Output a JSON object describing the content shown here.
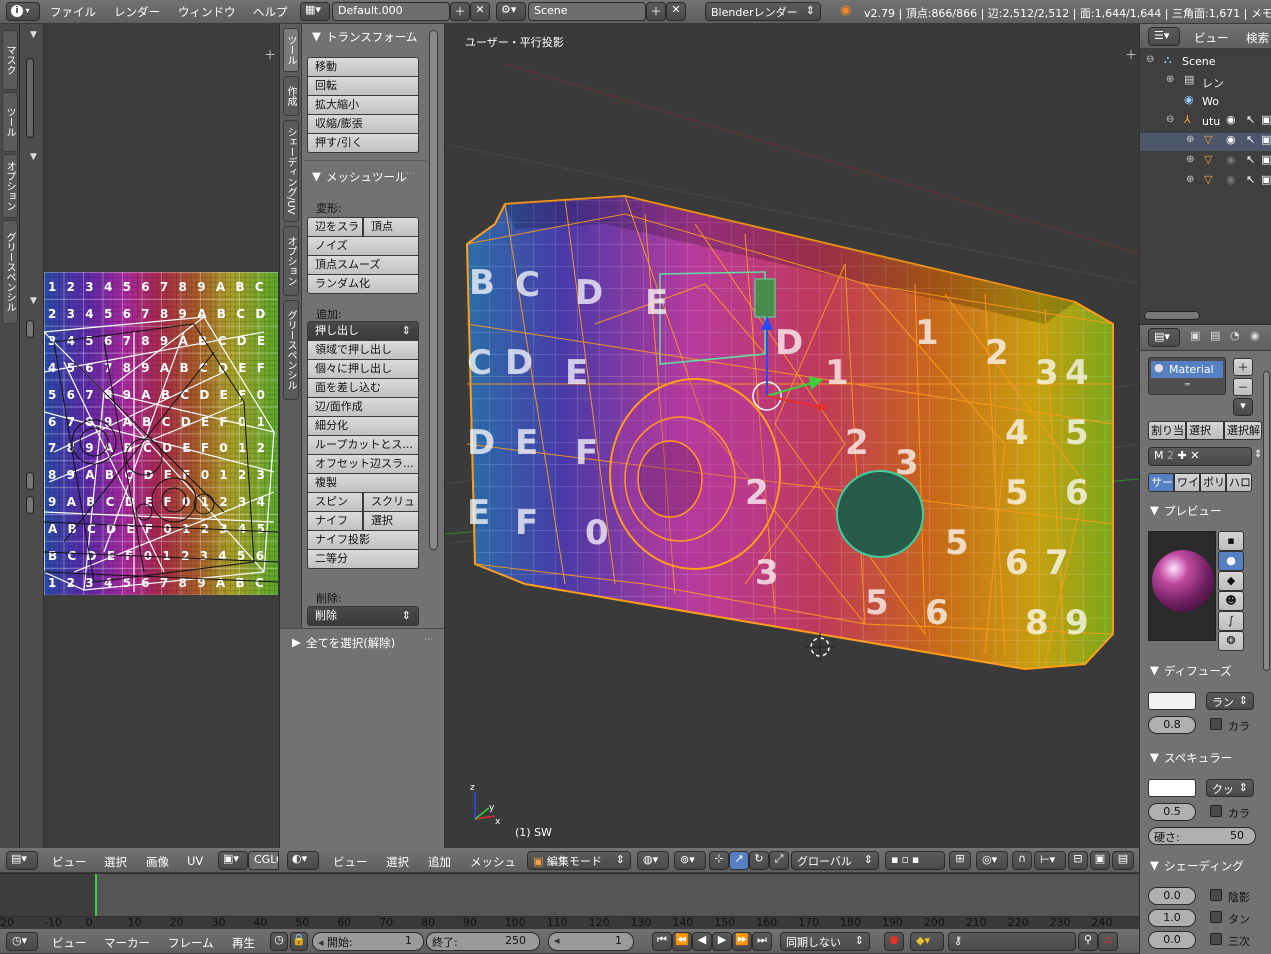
{
  "app": {
    "info_icon": "info-icon",
    "menus": [
      "ファイル",
      "レンダー",
      "ウィンドウ",
      "ヘルプ"
    ],
    "screen_layout": "Default.000",
    "scene": "Scene",
    "engine": "Blenderレンダー",
    "stats": "v2.79 | 頂点:866/866 | 辺:2,512/2,512 | 面:1,644/1,644 | 三角面:1,671 | メモリ"
  },
  "uv_editor": {
    "side_tabs": [
      "マスク",
      "ツール",
      "オプション",
      "グリースペンシル"
    ],
    "grid_rows": [
      "1 2 3 4 5 6 7 8 9 A B C",
      "2 3 4 5 6 7 8 9 A B C D",
      "3 4 5 6 7 8 9 A B C D E",
      "4 5 6 7 8 9 A B C D E F",
      "5 6 7 8 9 A B C D E F 0",
      "6 7 8 9 A B C D E F 0 1",
      "7 8 9 A B C D E F 0 1 2",
      "8 9 A B C D E F 0 1 2 3",
      "9 A B C D E F 0 1 2 3 4",
      "A B C D E F 0 1 2 3 4 5",
      "B C D E F 0 1 2 3 4 5 6",
      "1 2 3 4 5 6 7 8 9 A B C"
    ],
    "header_menus": [
      "ビュー",
      "選択",
      "画像",
      "UV"
    ],
    "image_name": "CGLO"
  },
  "tool_shelf": {
    "tabs": [
      "ツール",
      "作成",
      "シェーディング/UV",
      "オプション",
      "グリースペンシル"
    ],
    "transform": {
      "title": "トランスフォーム",
      "buttons": [
        "移動",
        "回転",
        "拡大縮小",
        "収縮/膨張",
        "押す/引く"
      ]
    },
    "mesh_tools": {
      "title": "メッシュツール",
      "deform_label": "変形:",
      "slide_edge": "辺をスラ",
      "slide_vertex": "頂点",
      "deform_buttons": [
        "ノイズ",
        "頂点スムーズ",
        "ランダム化"
      ],
      "add_label": "追加:",
      "extrude": "押し出し",
      "add_buttons": [
        "領域で押し出し",
        "個々に押し出し",
        "面を差し込む",
        "辺/面作成",
        "細分化",
        "ループカットとス...",
        "オフセット辺スラ...",
        "複製"
      ],
      "spin": "スピン",
      "screw": "スクリュ",
      "knife": "ナイフ",
      "select": "選択",
      "knife_project": "ナイフ投影",
      "bisect": "二等分",
      "delete_label": "削除:",
      "delete": "削除"
    },
    "select_all": "全てを選択(解除)"
  },
  "viewport": {
    "view_label": "ユーザー・平行投影",
    "object_label": "(1) SW",
    "header_menus": [
      "ビュー",
      "選択",
      "追加",
      "メッシュ"
    ],
    "mode": "編集モード",
    "orientation": "グローバル"
  },
  "outliner": {
    "header_menus": [
      "ビュー",
      "検索"
    ],
    "items": [
      "Scene",
      "レン",
      "Wo",
      "utu"
    ]
  },
  "properties": {
    "material_name": "Material",
    "material_buttons": [
      "割り当",
      "選択",
      "選択解"
    ],
    "slot_field": "M",
    "type_tabs": [
      "サー",
      "ワイ",
      "ポリ",
      "ハロ"
    ],
    "preview_title": "プレビュー",
    "diffuse": {
      "title": "ディフューズ",
      "shader": "ラン",
      "intensity": "0.8",
      "ramp": "カラ"
    },
    "specular": {
      "title": "スペキュラー",
      "shader": "クッ",
      "intensity": "0.5",
      "ramp": "カラ",
      "hardness_label": "硬さ:",
      "hardness": "50"
    },
    "shading": {
      "title": "シェーディング",
      "emit": "0.0",
      "shadeless": "陰影",
      "translucency": "1.0",
      "tangent": "タン",
      "ambient": "0.0",
      "cubic": "三次"
    }
  },
  "timeline": {
    "ticks": [
      "-20",
      "-10",
      "0",
      "10",
      "20",
      "30",
      "40",
      "50",
      "60",
      "70",
      "80",
      "90",
      "100",
      "110",
      "120",
      "130",
      "140",
      "150",
      "160",
      "170",
      "180",
      "190",
      "200",
      "210",
      "220",
      "230",
      "240"
    ],
    "header_menus": [
      "ビュー",
      "マーカー",
      "フレーム",
      "再生"
    ],
    "start_label": "開始:",
    "start": "1",
    "end_label": "終了:",
    "end": "250",
    "current": "1",
    "sync": "同期しない"
  },
  "colors": {
    "wire": "#ff9d1a",
    "timeline_cursor": "#3ccf3c",
    "accent_blue": "#5680c2"
  }
}
